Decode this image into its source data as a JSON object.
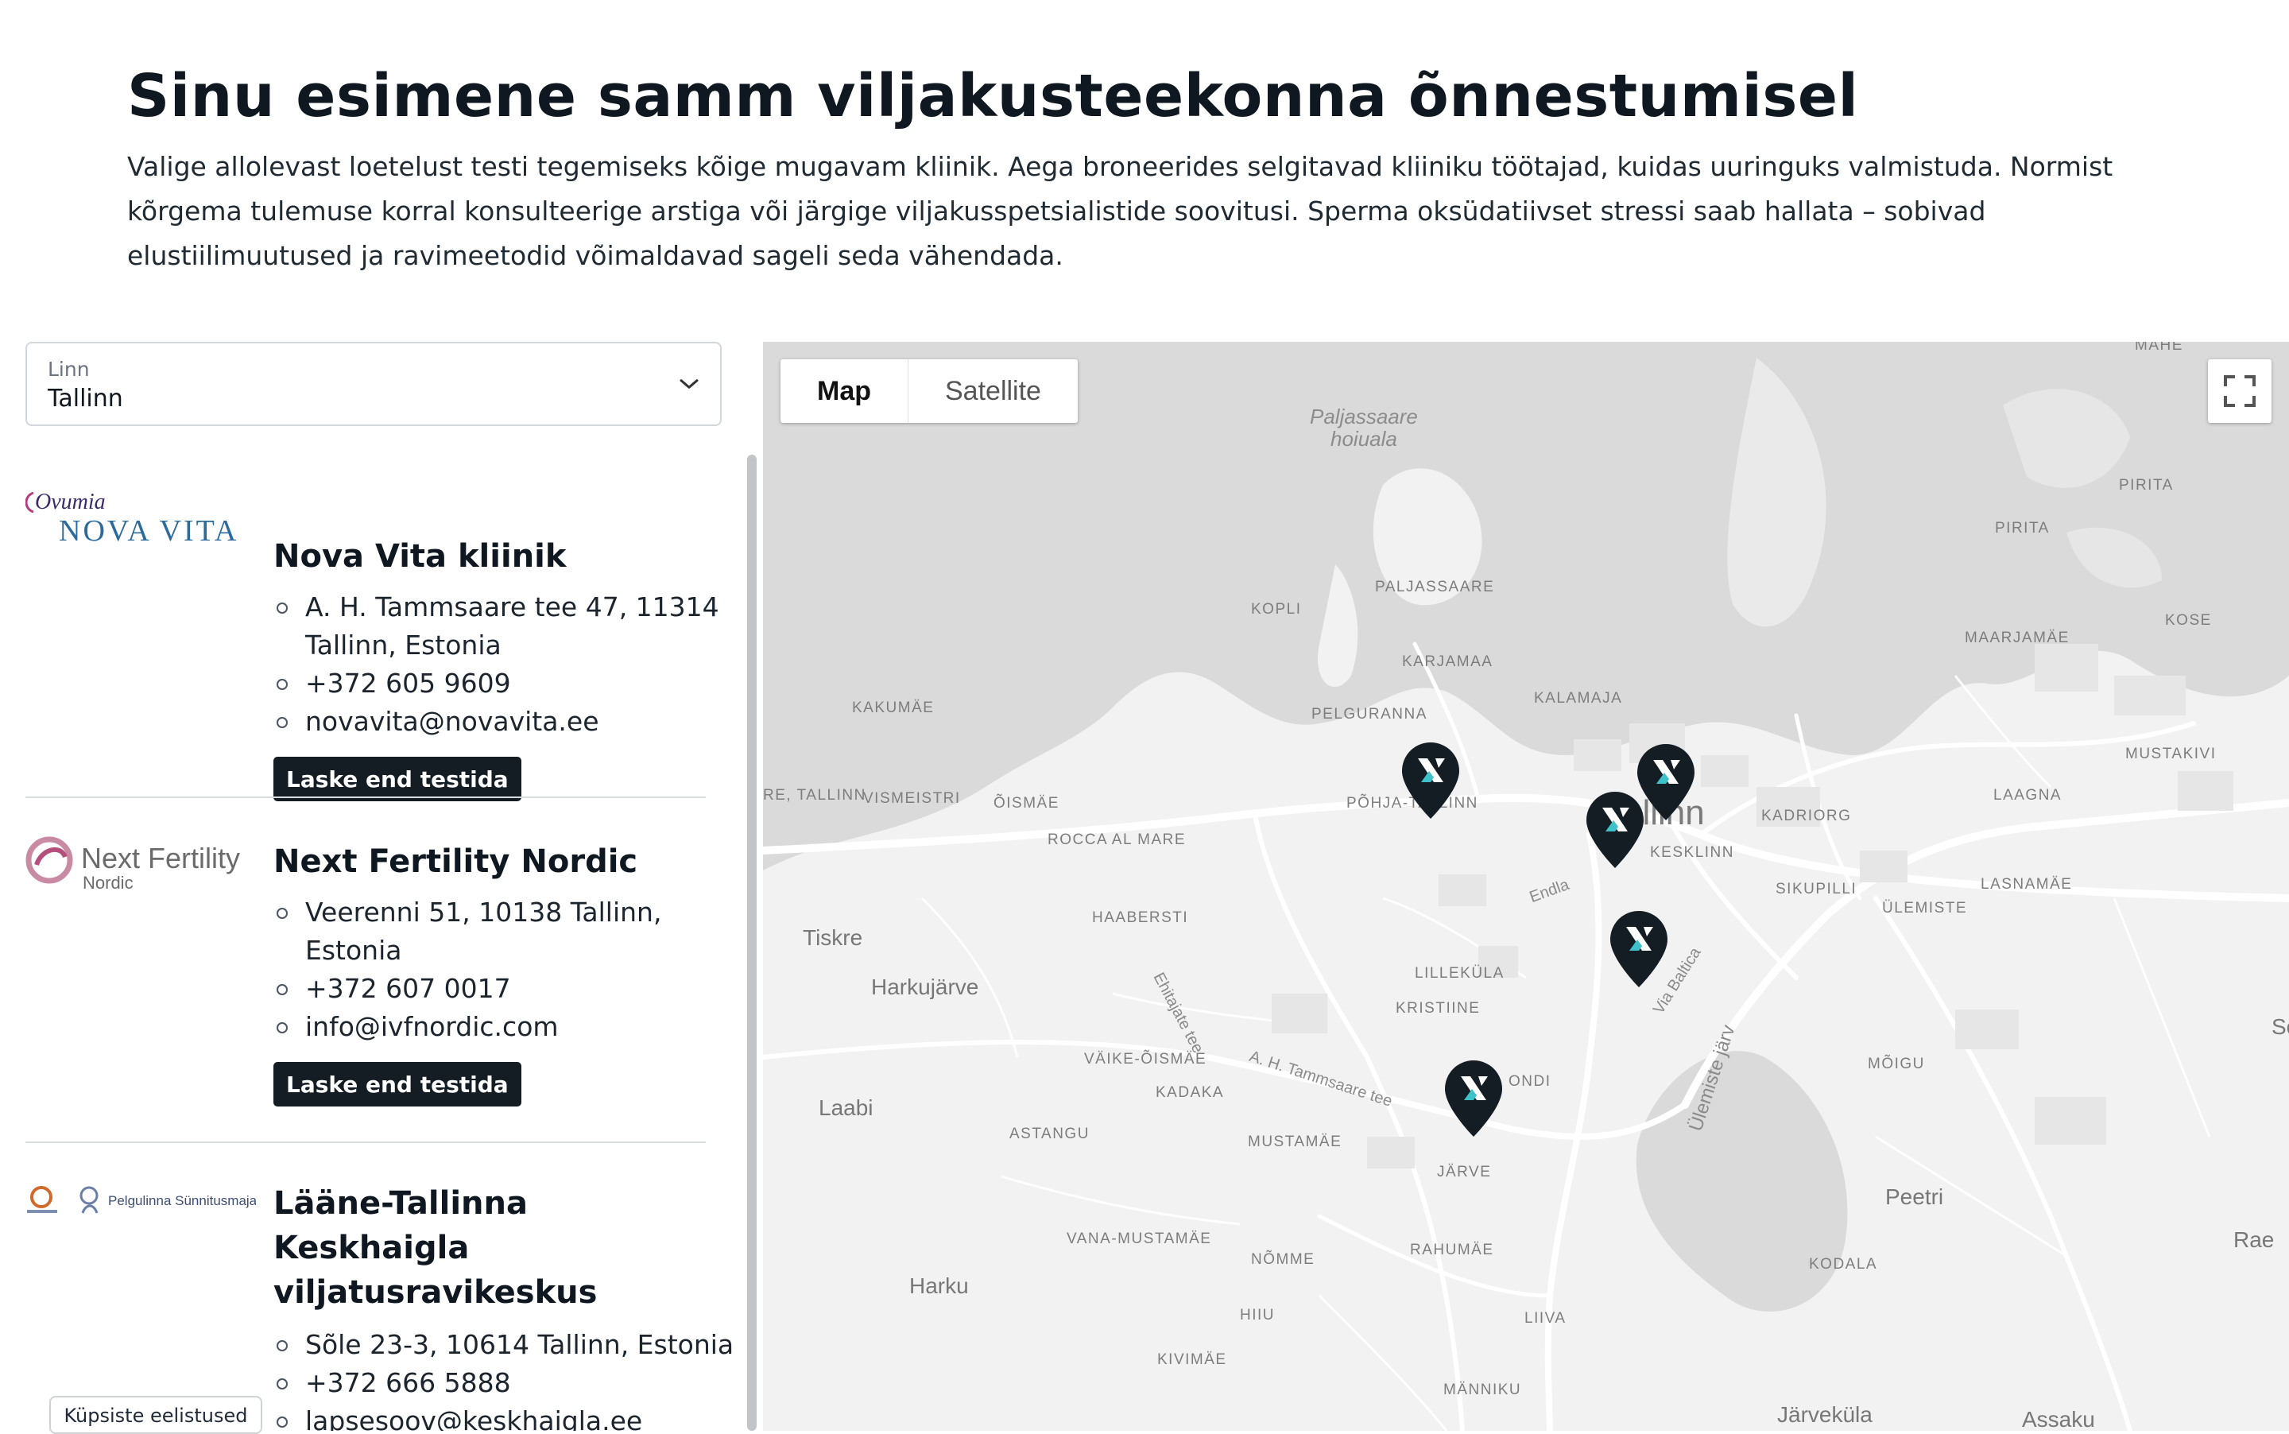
{
  "header": {
    "title": "Sinu esimene samm viljakusteekonna õnnestumisel",
    "intro": "Valige allolevast loetelust testi tegemiseks kõige mugavam kliinik. Aega broneerides selgitavad kliiniku töötajad, kuidas uuringuks valmistuda. Normist kõrgema tulemuse korral konsulteerige arstiga või järgige viljakusspetsialistide soovitusi. Sperma oksüdatiivset stressi saab hallata – sobivad elustiilimuutused ja ravimeetodid võimaldavad sageli seda vähendada."
  },
  "city_select": {
    "label": "Linn",
    "value": "Tallinn",
    "icon": "chevron-down-icon"
  },
  "clinics": [
    {
      "logo_line1": "Ovumia",
      "logo_line2": "NOVA VITA",
      "name": "Nova Vita kliinik",
      "address_line1": "A. H. Tammsaare tee 47, 11314",
      "address_line2": "Tallinn, Estonia",
      "phone": "+372 605 9609",
      "email": "novavita@novavita.ee",
      "cta": "Laske end testida"
    },
    {
      "logo_line1": "Next Fertility",
      "logo_line2": "Nordic",
      "name": "Next Fertility Nordic",
      "address_line1": "Veerenni 51, 10138 Tallinn,",
      "address_line2": "Estonia",
      "phone": "+372 607 0017",
      "email": "info@ivfnordic.com",
      "cta": "Laske end testida"
    },
    {
      "logo_line1": "Pelgulinna Sünnitusmaja",
      "name_line1": "Lääne-Tallinna",
      "name_line2": "Keskhaigla",
      "name_line3": "viljatusravikeskus",
      "address": "Sõle 23-3, 10614 Tallinn, Estonia",
      "phone": "+372 666 5888",
      "email": "lapsesoov@keskhaigla.ee"
    }
  ],
  "cookie_button": "Küpsiste eelistused",
  "map": {
    "tabs": [
      "Map",
      "Satellite"
    ],
    "active_tab": "Map",
    "fullscreen_icon": "fullscreen-icon",
    "labels": {
      "paljassaare_hoiuala_1": "Paljassaare",
      "paljassaare_hoiuala_2": "hoiuala",
      "paljassaare": "PALJASSAARE",
      "kopli": "KOPLI",
      "karjamaa": "KARJAMAA",
      "kalamaja": "KALAMAJA",
      "pelguranna": "PELGURANNA",
      "kakumae": "KAKUMÄE",
      "pohja_tallinn": "PÕHJA-TALLINN",
      "tallinn": "Tallinn",
      "kesklinn": "KESKLINN",
      "kadriorg": "KADRIORG",
      "sikupilli": "SIKUPILLI",
      "ulemiste": "ÜLEMISTE",
      "lasnamae": "LASNAMÄE",
      "laagna": "LAAGNA",
      "mustakivi": "MUSTAKIVI",
      "kose": "KOSE",
      "maarjamae": "MAARJAMÄE",
      "pirita": "PIRITA",
      "pirita2": "PIRITA",
      "mahe": "MAHE",
      "vismeistri": "VISMEISTRI",
      "re_tallinn": "RE, TALLINN",
      "oismae": "ÕISMÄE",
      "rocca": "ROCCA AL MARE",
      "haabersti": "HAABERSTI",
      "tiskre": "Tiskre",
      "harkujarve": "Harkujärve",
      "lillekula": "LILLEKÜLA",
      "kristiine": "KRISTIINE",
      "vaike_oismae": "VÄIKE-ÕISMÄE",
      "kadaka": "KADAKA",
      "astangu": "ASTANGU",
      "mustamae": "MUSTAMÄE",
      "jarve": "JÄRVE",
      "ondi": "ONDI",
      "laabi": "Laabi",
      "vana_mustamae": "VANA-MUSTAMÄE",
      "nomme": "NÕMME",
      "rahumae": "RAHUMÄE",
      "harku": "Harku",
      "hiiu": "HIIU",
      "liiva": "LIIVA",
      "kivimae": "KIVIMÄE",
      "manniku": "MÄNNIKU",
      "kodala": "KODALA",
      "peetri": "Peetri",
      "rae": "Rae",
      "mogu": "MÕIGU",
      "jarvekula": "Järveküla",
      "assaku": "Assaku",
      "ulemiste_jarv": "Ülemiste järv",
      "endla": "Endla",
      "via_baltica": "Via Baltica",
      "ehitajate_tee": "Ehitajate tee",
      "tammsaare_tee": "A. H. Tammsaare tee",
      "so": "So"
    },
    "marker_icon": "clinic-marker-icon"
  }
}
